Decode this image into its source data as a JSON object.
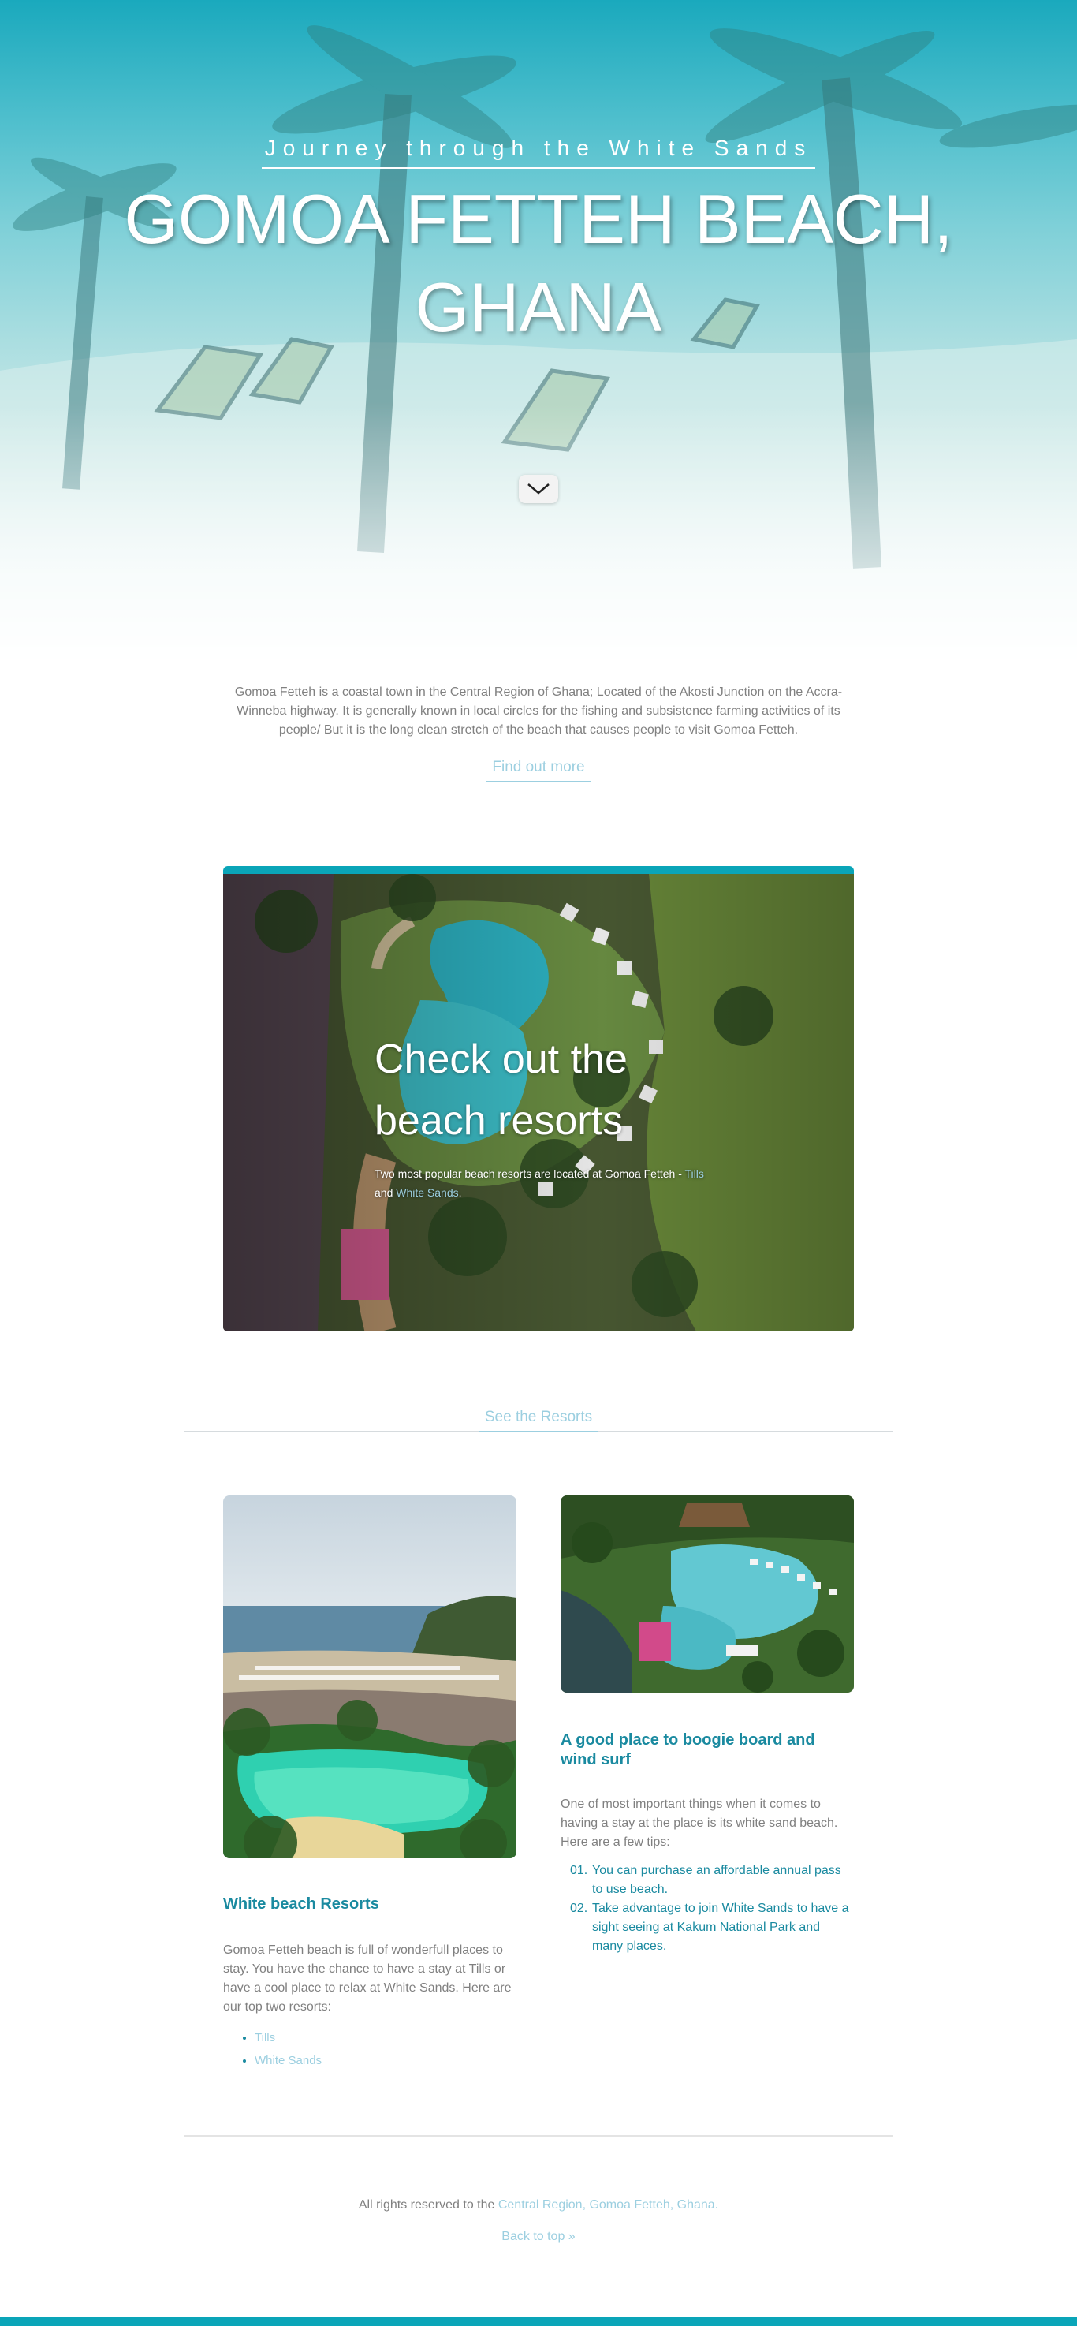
{
  "hero": {
    "subtitle": "Journey through the White Sands",
    "title_line1": "GOMOA FETTEH BEACH,",
    "title_line2": "GHANA",
    "scroll_icon": "chevron-down-icon"
  },
  "intro": {
    "text": "Gomoa Fetteh is a coastal town in the Central Region of Ghana; Located of the Akosti Junction on the Accra-Winneba highway. It is generally known in local circles for the fishing and subsistence farming activities of its people/ But it is the long clean stretch of the beach that causes people to visit Gomoa Fetteh.",
    "button": "Find out more"
  },
  "resorts_card": {
    "heading": "Check out the beach resorts",
    "text_before": "Two most popular beach resorts are located at Gomoa Fetteh - ",
    "link1": "Tills",
    "text_mid": " and ",
    "link2": "White Sands",
    "text_after": ".",
    "accent_color": "#0aa5b8"
  },
  "see_resorts": {
    "button": "See the Resorts"
  },
  "left_col": {
    "heading": "White beach Resorts",
    "text": "Gomoa Fetteh beach is full of wonderfull places to stay. You have the chance to have a stay at Tills or have a cool place to relax at White Sands. Here are our top two resorts:",
    "links": [
      "Tills",
      "White Sands"
    ]
  },
  "right_col": {
    "heading": "A good place to boogie board and wind surf",
    "text": "One of most important things when it comes to having a stay at the place is its white sand beach. Here are a few tips:",
    "tips": [
      {
        "num": "01.",
        "text": "You can purchase an affordable annual pass to use beach."
      },
      {
        "num": "02.",
        "text": "Take advantage to join White Sands to have a sight seeing at Kakum National Park and many places."
      }
    ]
  },
  "footer": {
    "text": "All rights reserved to the ",
    "link": "Central Region, Gomoa Fetteh, Ghana.",
    "back_to_top": "Back to top »"
  }
}
